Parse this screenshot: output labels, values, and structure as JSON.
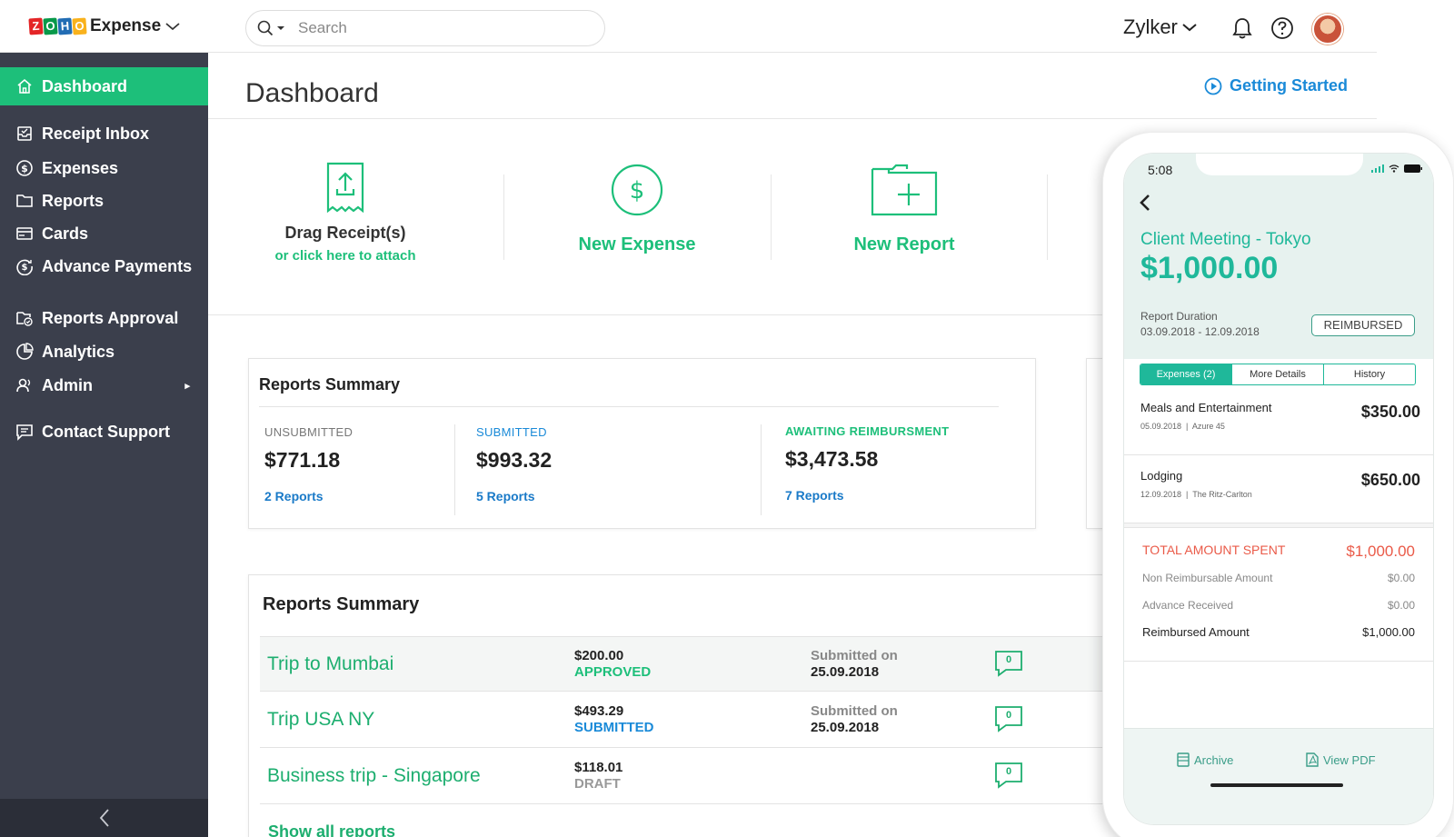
{
  "header": {
    "logo_letters": [
      "Z",
      "O",
      "H",
      "O"
    ],
    "logo_colors": [
      "#e42527",
      "#089949",
      "#226db4",
      "#f9b21d"
    ],
    "product_name": "Expense",
    "search_placeholder": "Search",
    "org_name": "Zylker",
    "icons": [
      "search-icon",
      "chevron-down-icon",
      "bell-icon",
      "help-icon",
      "avatar"
    ]
  },
  "sidebar": {
    "items": [
      {
        "label": "Dashboard",
        "icon": "home-icon",
        "active": true
      },
      {
        "label": "Receipt Inbox",
        "icon": "inbox-icon"
      },
      {
        "label": "Expenses",
        "icon": "dollar-icon"
      },
      {
        "label": "Reports",
        "icon": "folder-icon"
      },
      {
        "label": "Cards",
        "icon": "card-icon"
      },
      {
        "label": "Advance Payments",
        "icon": "advance-icon"
      },
      {
        "label": "Reports Approval",
        "icon": "approval-icon"
      },
      {
        "label": "Analytics",
        "icon": "pie-icon"
      },
      {
        "label": "Admin",
        "icon": "admin-icon"
      },
      {
        "label": "Contact Support",
        "icon": "chat-icon"
      }
    ],
    "admin_arrow": "▸"
  },
  "main": {
    "title": "Dashboard",
    "getting_started": "Getting Started",
    "quick_actions": {
      "drag_title": "Drag Receipt(s)",
      "drag_sub": "or click here to attach",
      "new_expense": "New Expense",
      "new_report": "New Report"
    },
    "summary_card": {
      "title": "Reports Summary",
      "columns": [
        {
          "label": "UNSUBMITTED",
          "amount": "$771.18",
          "link": "2 Reports",
          "color": "#777777"
        },
        {
          "label": "SUBMITTED",
          "amount": "$993.32",
          "link": "5 Reports",
          "color": "#1a8ad8"
        },
        {
          "label": "AWAITING REIMBURSMENT",
          "amount": "$3,473.58",
          "link": "7 Reports",
          "color": "#1dbf7a"
        }
      ]
    },
    "reports_card": {
      "title": "Reports Summary",
      "rows": [
        {
          "name": "Trip to Mumbai",
          "amount": "$200.00",
          "status": "APPROVED",
          "status_color": "#1dbf7a",
          "submitted_label": "Submitted on",
          "date": "25.09.2018",
          "comments": "0"
        },
        {
          "name": "Trip USA NY",
          "amount": "$493.29",
          "status": "SUBMITTED",
          "status_color": "#1a8ad8",
          "submitted_label": "Submitted on",
          "date": "25.09.2018",
          "comments": "0"
        },
        {
          "name": "Business trip - Singapore",
          "amount": "$118.01",
          "status": "DRAFT",
          "status_color": "#999999",
          "submitted_label": "",
          "date": "",
          "comments": "0"
        }
      ],
      "show_all": "Show all reports"
    }
  },
  "phone": {
    "time": "5:08",
    "trip_name": "Client Meeting - Tokyo",
    "total": "$1,000.00",
    "duration_label": "Report Duration",
    "duration": "03.09.2018 - 12.09.2018",
    "status_badge": "REIMBURSED",
    "tabs": [
      "Expenses (2)",
      "More Details",
      "History"
    ],
    "expenses": [
      {
        "name": "Meals and Entertainment",
        "date": "05.09.2018",
        "merchant": "Azure 45",
        "amount": "$350.00"
      },
      {
        "name": "Lodging",
        "date": "12.09.2018",
        "merchant": "The Ritz-Carlton",
        "amount": "$650.00"
      }
    ],
    "totals": {
      "total_label": "TOTAL AMOUNT SPENT",
      "total_value": "$1,000.00",
      "non_reimb_label": "Non Reimbursable Amount",
      "non_reimb_value": "$0.00",
      "advance_label": "Advance Received",
      "advance_value": "$0.00",
      "reimb_label": "Reimbursed Amount",
      "reimb_value": "$1,000.00"
    },
    "actions": {
      "archive": "Archive",
      "view_pdf": "View PDF"
    }
  },
  "colors": {
    "accent": "#1dbf7a",
    "sidebar": "#3b3f4c",
    "link": "#1a8ad8",
    "phone_accent": "#1fb89a",
    "total_red": "#ea5a48"
  }
}
